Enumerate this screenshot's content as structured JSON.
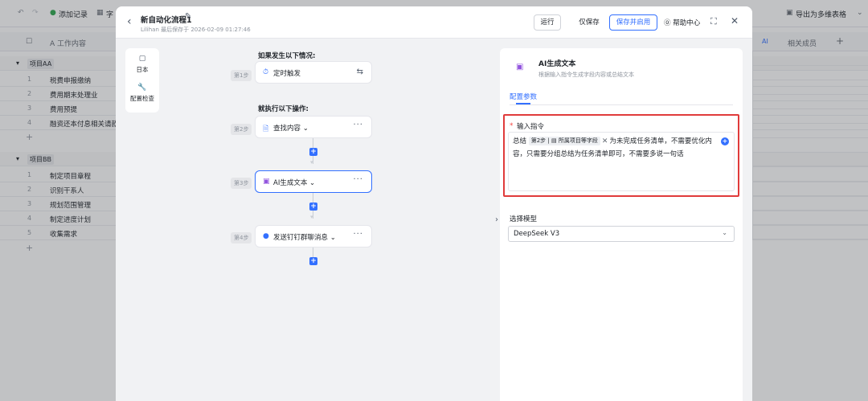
{
  "background": {
    "toolbar": {
      "add_record": "添加记录",
      "field_prefix": "字",
      "export_label": "导出为多维表格"
    },
    "header": {
      "column_title": "A 工作内容",
      "related_members": "相关成员",
      "ai_badge": "AI"
    },
    "group_a": {
      "label": "项目AA",
      "rows": [
        {
          "num": "1",
          "text": "税费申报缴纳"
        },
        {
          "num": "2",
          "text": "费用期末处理业"
        },
        {
          "num": "3",
          "text": "费用预提"
        },
        {
          "num": "4",
          "text": "融资还本付息相关请款"
        }
      ]
    },
    "group_b": {
      "label": "项目BB",
      "rows": [
        {
          "num": "1",
          "text": "制定项目章程"
        },
        {
          "num": "2",
          "text": "识别干系人"
        },
        {
          "num": "3",
          "text": "规划范围管理"
        },
        {
          "num": "4",
          "text": "制定进度计划"
        },
        {
          "num": "5",
          "text": "收集需求"
        }
      ]
    }
  },
  "modal": {
    "title": "新自动化流程1",
    "subtitle": "Lilihan 最后保存于 2026-02-09 01:27:46",
    "buttons": {
      "run": "运行",
      "save_only": "仅保存",
      "save_enable": "保存并启用",
      "help": "帮助中心"
    },
    "side_menu": {
      "log": "日本",
      "config_check": "配置检查"
    },
    "flow": {
      "trigger_title": "如果发生以下情况:",
      "action_title": "就执行以下操作:",
      "steps": [
        {
          "badge": "第1步",
          "label": "定时触发"
        },
        {
          "badge": "第2步",
          "label": "查找内容"
        },
        {
          "badge": "第3步",
          "label": "AI生成文本"
        },
        {
          "badge": "第4步",
          "label": "发送钉钉群聊消息"
        }
      ]
    },
    "panel": {
      "title": "AI生成文本",
      "desc": "根据输入指令生成字段内容或总结文本",
      "tab": "配置参数",
      "prompt_label": "输入指令",
      "prompt_prefix": "总结",
      "chip_step": "第2步",
      "chip_field": "所属项目等字段",
      "prompt_line1_rest": "为未完成任务清单，不需要优化内",
      "prompt_line2": "容，只需要分组总结为任务清单即可，不需要多说一句话",
      "model_label": "选择模型",
      "model_value": "DeepSeek V3"
    }
  },
  "colors": {
    "accent": "#3370ff",
    "highlight_border": "#e03b3b"
  }
}
